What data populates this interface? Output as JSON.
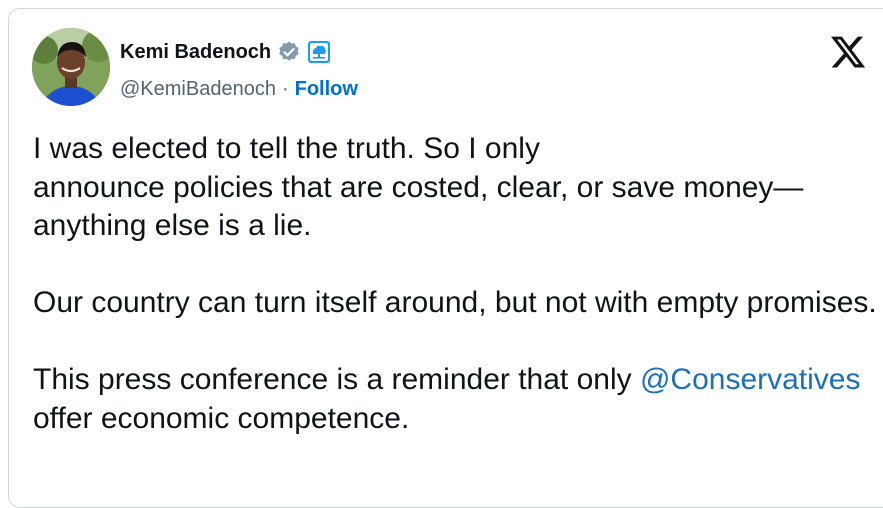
{
  "author": {
    "display_name": "Kemi Badenoch",
    "handle": "@KemiBadenoch",
    "separator": "·",
    "follow_label": "Follow",
    "verified": true,
    "verified_badge_color": "#829aab",
    "affiliation_badge_color": "#1d9bf0"
  },
  "tweet": {
    "paragraph_1": "I was elected to tell the truth. So I only",
    "paragraph_1b": "announce policies that are costed, clear, or save money—anything else is a lie.",
    "paragraph_2": "Our country can turn itself around, but not with empty promises.",
    "paragraph_3_pre": "This press conference is a reminder that only ",
    "paragraph_3_mention": "@Conservatives",
    "paragraph_3_post": " offer economic competence."
  },
  "colors": {
    "text": "#0f1419",
    "secondary_text": "#536471",
    "link": "#006fd6",
    "border": "#cfd9de"
  },
  "icons": {
    "logo": "x-logo-icon",
    "verified": "verified-badge-icon",
    "affiliation": "conservatives-tree-icon"
  }
}
